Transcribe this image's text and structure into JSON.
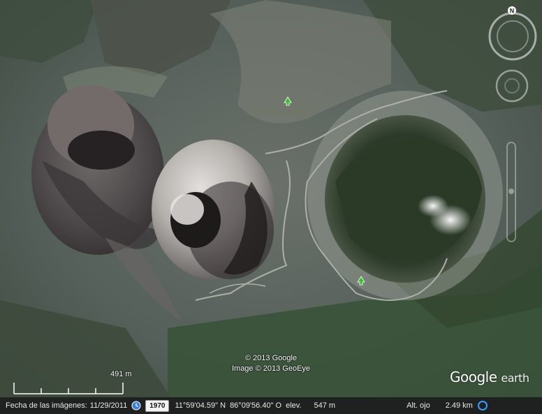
{
  "map": {
    "copyright_lines": [
      "© 2013 Google",
      "Image © 2013 GeoEye"
    ],
    "scale_label": "491 m",
    "logo": {
      "main": "Google",
      "suffix": "earth"
    },
    "compass_label": "N",
    "markers": [
      {
        "name": "tree-marker-north",
        "color": "#35c12e"
      },
      {
        "name": "tree-marker-south",
        "color": "#35c12e"
      }
    ]
  },
  "status": {
    "imagery_label": "Fecha de las imágenes:",
    "imagery_date": "11/29/2011",
    "year_button": "1970",
    "latitude": "11°59'04.59\" N",
    "longitude": "86°09'56.40\" O",
    "elevation_label": "elev.",
    "elevation_value": "547 m",
    "eye_label": "Alt. ojo",
    "eye_value": "2.49 km"
  }
}
